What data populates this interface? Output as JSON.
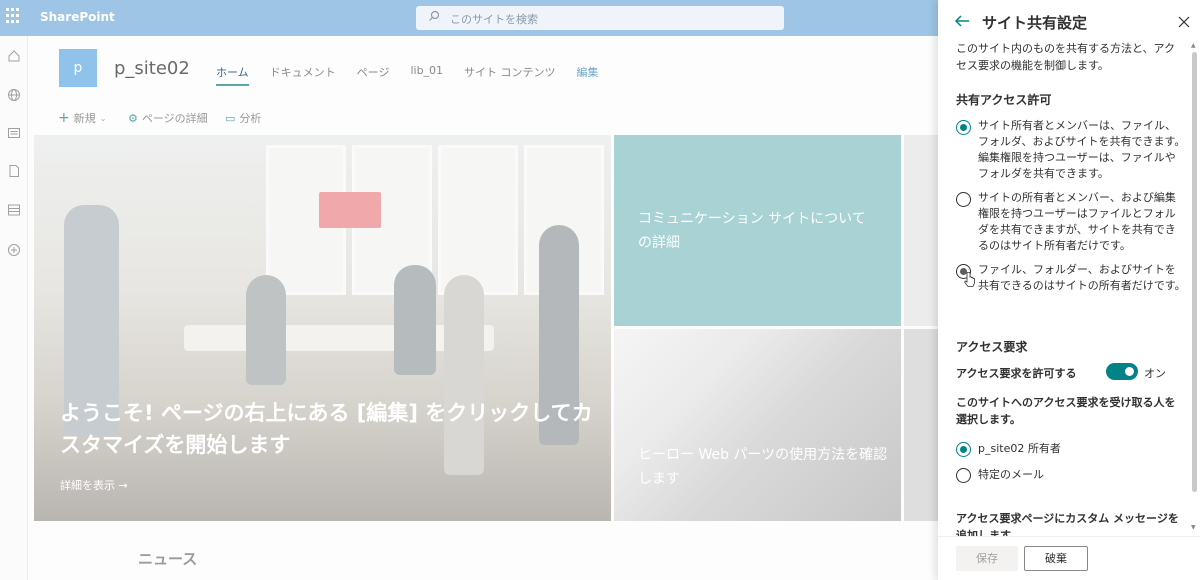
{
  "suitebar": {
    "brand": "SharePoint",
    "search_placeholder": "このサイトを検索",
    "bg_color": "#9ec5e6"
  },
  "site": {
    "logo_letter": "p",
    "name": "p_site02",
    "nav": [
      {
        "label": "ホーム",
        "active": true
      },
      {
        "label": "ドキュメント"
      },
      {
        "label": "ページ"
      },
      {
        "label": "lib_01"
      },
      {
        "label": "サイト コンテンツ"
      },
      {
        "label": "編集"
      }
    ]
  },
  "cmdbar": {
    "new_label": "新規",
    "page_details_label": "ページの詳細",
    "analytics_label": "分析"
  },
  "hero": {
    "main_title": "ようこそ! ページの右上にある [編集] をクリックしてカスタマイズを開始します",
    "main_link": "詳細を表示 →",
    "teal_title": "コミュニケーション サイトについての詳細",
    "stair_title": "ヒーロー Web パーツの使用方法を確認します"
  },
  "news_heading": "ニュース",
  "panel": {
    "title": "サイト共有設定",
    "description": "このサイト内のものを共有する方法と、アクセス要求の機能を制御します。",
    "sharing_heading": "共有アクセス許可",
    "sharing_options": [
      {
        "text": "サイト所有者とメンバーは、ファイル、フォルダ、およびサイトを共有できます。編集権限を持つユーザーは、ファイルやフォルダを共有できます。",
        "state": "selected"
      },
      {
        "text": "サイトの所有者とメンバー、および編集権限を持つユーザーはファイルとフォルダを共有できますが、サイトを共有できるのはサイト所有者だけです。",
        "state": "unselected"
      },
      {
        "text": "ファイル、フォルダー、およびサイトを共有できるのはサイトの所有者だけです。",
        "state": "hover"
      }
    ],
    "access_heading": "アクセス要求",
    "allow_label": "アクセス要求を許可する",
    "toggle_state": "オン",
    "receive_label": "このサイトへのアクセス要求を受け取る人を選択します。",
    "receive_options": [
      {
        "text": "p_site02 所有者",
        "state": "selected"
      },
      {
        "text": "特定のメール",
        "state": "unselected"
      }
    ],
    "custom_message_label": "アクセス要求ページにカスタム メッセージを追加します",
    "save_label": "保存",
    "discard_label": "破棄",
    "accent_color": "#038387"
  }
}
